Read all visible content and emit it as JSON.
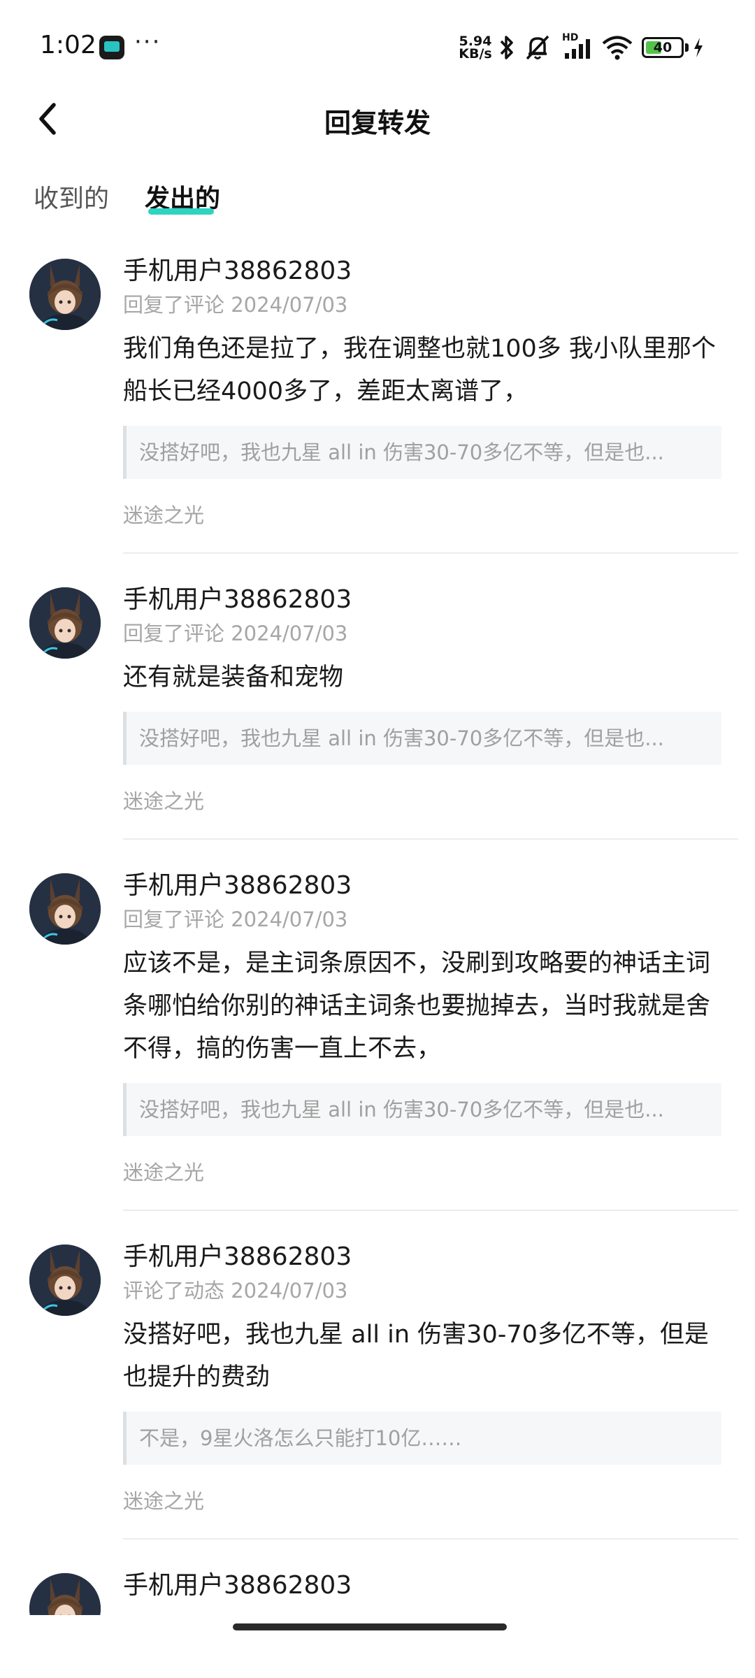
{
  "status_bar": {
    "time": "1:02",
    "net_speed_value": "5.94",
    "net_speed_unit": "KB/s",
    "signal_label": "HD",
    "battery_level": "40",
    "icons": [
      "app-icon",
      "more-dots-icon",
      "bluetooth-icon",
      "mute-icon",
      "signal-icon",
      "wifi-icon",
      "battery-icon",
      "charging-icon"
    ],
    "battery_color": "#55c24b"
  },
  "header": {
    "title": "回复转发",
    "back_icon": "back-chevron-icon"
  },
  "tabs": [
    {
      "label": "收到的",
      "active": false
    },
    {
      "label": "发出的",
      "active": true
    }
  ],
  "accent_color": "#2ed3c2",
  "items": [
    {
      "username": "手机用户38862803",
      "meta": "回复了评论 2024/07/03",
      "content": "我们角色还是拉了，我在调整也就100多 我小队里那个船长已经4000多了，差距太离谱了，",
      "quote": "没搭好吧，我也九星 all in 伤害30-70多亿不等，但是也...",
      "game": "迷途之光"
    },
    {
      "username": "手机用户38862803",
      "meta": "回复了评论 2024/07/03",
      "content": "还有就是装备和宠物",
      "quote": "没搭好吧，我也九星 all in 伤害30-70多亿不等，但是也...",
      "game": "迷途之光"
    },
    {
      "username": "手机用户38862803",
      "meta": "回复了评论 2024/07/03",
      "content": "应该不是，是主词条原因不，没刷到攻略要的神话主词条哪怕给你别的神话主词条也要抛掉去，当时我就是舍不得，搞的伤害一直上不去，",
      "quote": "没搭好吧，我也九星 all in 伤害30-70多亿不等，但是也...",
      "game": "迷途之光"
    },
    {
      "username": "手机用户38862803",
      "meta": "评论了动态 2024/07/03",
      "content": "没搭好吧，我也九星 all in 伤害30-70多亿不等，但是也提升的费劲",
      "quote": "不是，9星火洛怎么只能打10亿……",
      "game": "迷途之光"
    },
    {
      "username": "手机用户38862803"
    }
  ]
}
